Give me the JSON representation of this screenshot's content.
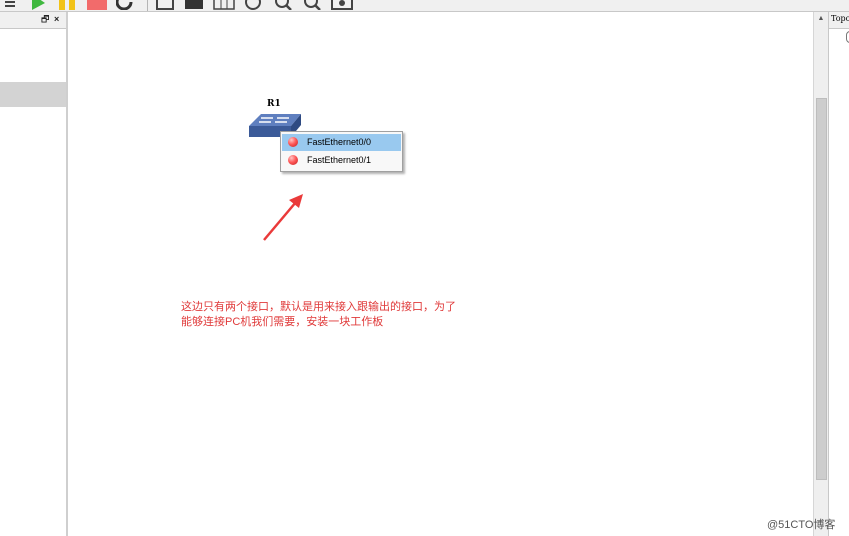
{
  "toolbar": {
    "icons": [
      "menu-icon",
      "play-icon",
      "pause-icon",
      "stop-icon",
      "reload-icon",
      "console-icon",
      "screenshot-icon",
      "grid-icon",
      "settings-icon",
      "zoom-in-icon",
      "zoom-out-icon",
      "camera-icon"
    ]
  },
  "left_dock": {
    "restore_label": "🗗",
    "close_label": "×"
  },
  "right_dock": {
    "title": "Topo…"
  },
  "scrollbar": {
    "up_arrow": "▲"
  },
  "topology": {
    "router": {
      "label": "R1"
    }
  },
  "context_menu": {
    "items": [
      {
        "label": "FastEthernet0/0",
        "status_color": "#e53935",
        "highlighted": true
      },
      {
        "label": "FastEthernet0/1",
        "status_color": "#e53935",
        "highlighted": false
      }
    ]
  },
  "annotation": {
    "line1": "这边只有两个接口，默认是用来接入跟输出的接口，为了",
    "line2": "能够连接PC机我们需要，安装一块工作板"
  },
  "watermark": "@51CTO博客",
  "colors": {
    "annotation": "#e03a3a",
    "menu_highlight": "#99c9ef",
    "router_blue": "#4a6cae"
  }
}
